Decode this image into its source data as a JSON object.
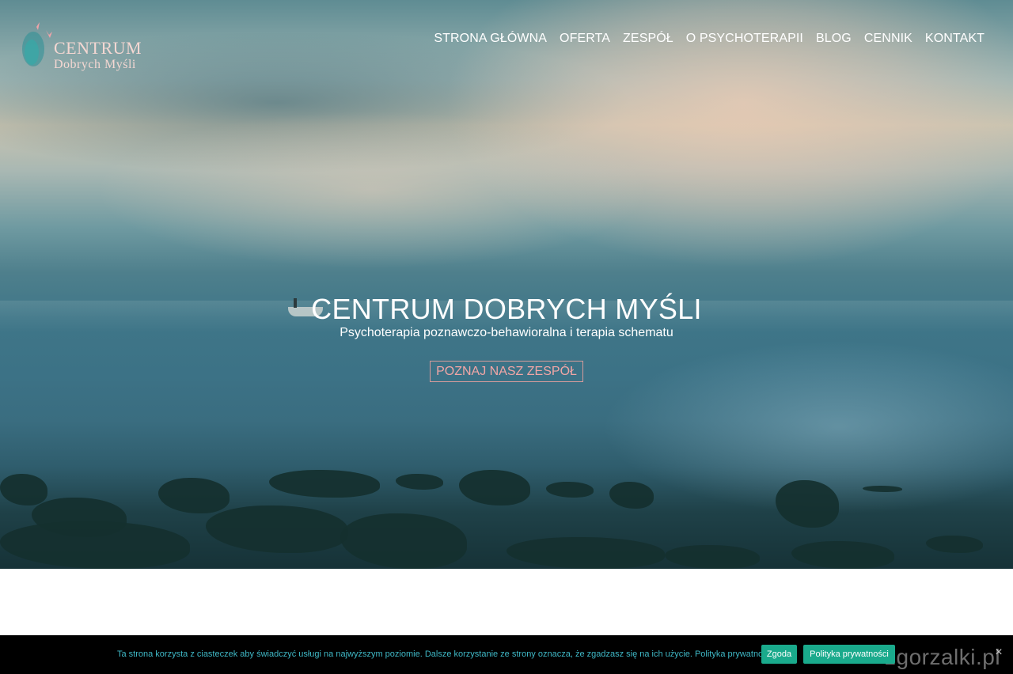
{
  "logo": {
    "title": "CENTRUM",
    "subtitle": "Dobrych Myśli",
    "accent_color": "#f4d7d2",
    "icon_color": "#2fa7a4"
  },
  "nav": {
    "items": [
      {
        "label": "STRONA GŁÓWNA"
      },
      {
        "label": "OFERTA"
      },
      {
        "label": "ZESPÓŁ"
      },
      {
        "label": "O PSYCHOTERAPII"
      },
      {
        "label": "BLOG"
      },
      {
        "label": "CENNIK"
      },
      {
        "label": "KONTAKT"
      }
    ]
  },
  "hero": {
    "title": "CENTRUM DOBRYCH MYŚLI",
    "subtitle": "Psychoterapia poznawczo-behawioralna i terapia schematu",
    "button_label": "POZNAJ NASZ ZESPÓŁ",
    "button_color": "#f1a6a6"
  },
  "cookie": {
    "text": "Ta strona korzysta z ciasteczek aby świadczyć usługi na najwyższym poziomie. Dalsze korzystanie ze strony oznacza, że zgadzasz się na ich użycie. Polityka prywatności",
    "accept_label": "Zgoda",
    "policy_label": "Polityka prywatności",
    "close_label": "×",
    "button_color": "#1aaa8c",
    "text_color": "#3fb8c6"
  },
  "watermark": "zgorzalki.pl"
}
